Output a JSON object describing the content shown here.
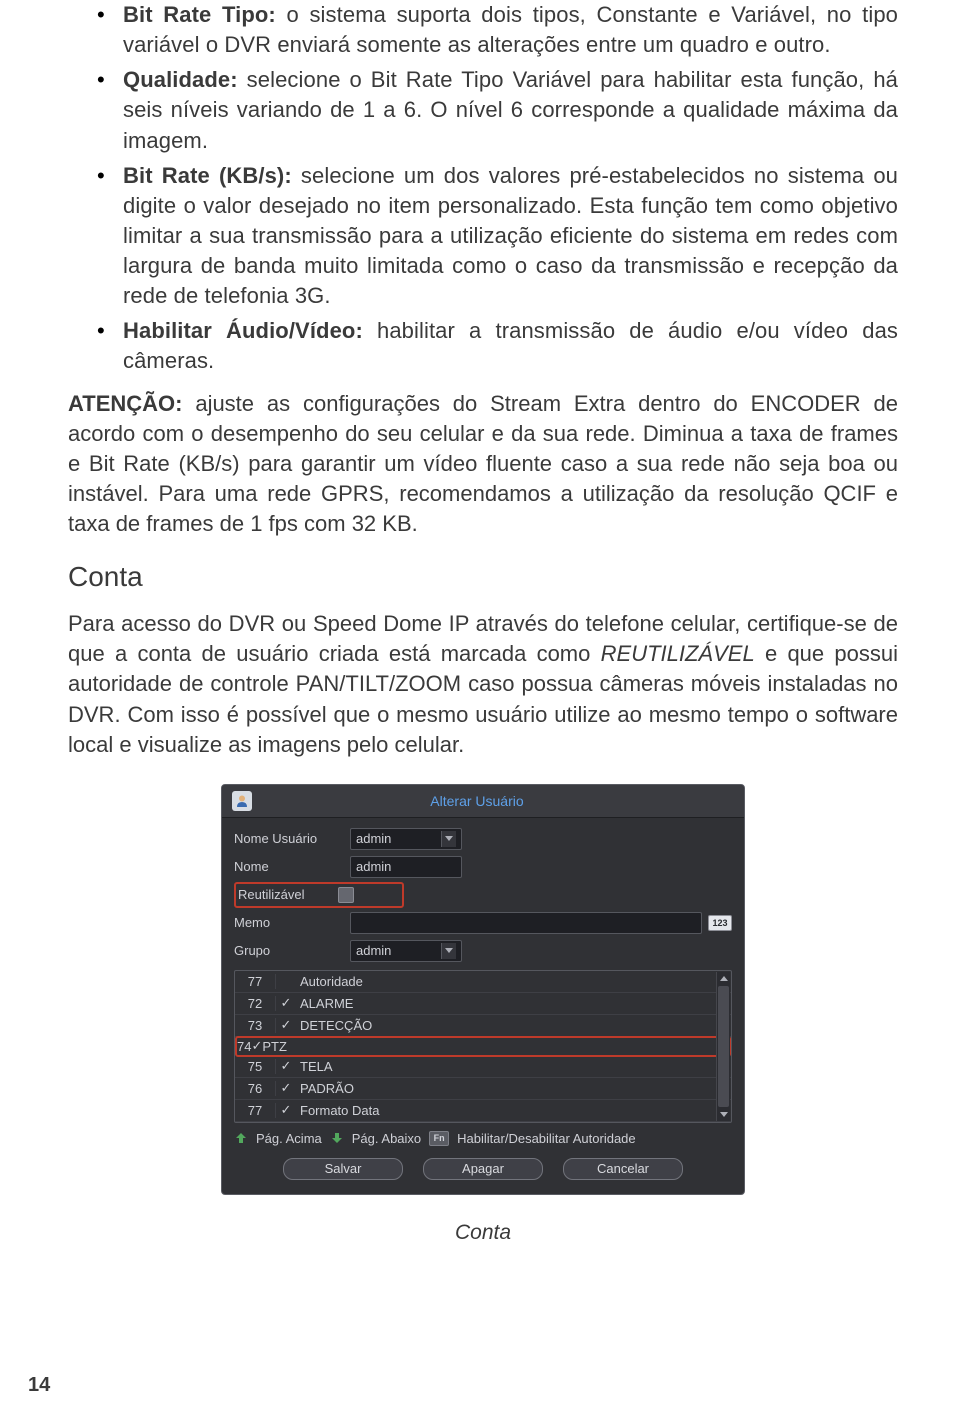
{
  "bullets": [
    {
      "label": "Bit Rate Tipo:",
      "text": "o sistema suporta dois tipos, Constante e Variável, no tipo variável o DVR enviará somente as alterações entre um quadro e outro."
    },
    {
      "label": "Qualidade:",
      "text": "selecione o Bit Rate Tipo Variável para habilitar esta função, há seis níveis variando de 1 a 6. O nível 6 corresponde a qualidade máxima da imagem."
    },
    {
      "label": "Bit Rate (KB/s):",
      "text": "selecione um dos valores pré-estabelecidos no sistema ou digite o valor desejado no item personalizado. Esta função tem como objetivo limitar a sua transmissão para a utilização eficiente do sistema em redes com largura de banda muito limitada como o caso da transmissão e recepção da rede de telefonia 3G."
    },
    {
      "label": "Habilitar Áudio/Vídeo:",
      "text": "habilitar a transmissão de áudio e/ou vídeo das câmeras."
    }
  ],
  "attention": {
    "label": "ATENÇÃO:",
    "text": "ajuste as configurações do Stream Extra dentro do ENCODER de acordo com o desempenho do seu celular e da sua rede. Diminua a taxa de frames e Bit Rate (KB/s) para garantir um vídeo fluente caso a sua rede não seja boa ou instável. Para uma rede GPRS, recomendamos a utilização da resolução QCIF e taxa de frames de 1 fps com 32 KB."
  },
  "section_title": "Conta",
  "account_paragraph_pre": "Para acesso do DVR ou Speed Dome IP através do telefone celular, certifique-se  de que a conta de usuário criada está marcada como ",
  "account_paragraph_em": "REUTILIZÁVEL",
  "account_paragraph_post": " e que possui autoridade de controle PAN/TILT/ZOOM caso possua câmeras móveis instaladas no DVR. Com isso é possível que o mesmo usuário utilize ao mesmo tempo o software local e visualize as imagens pelo celular.",
  "dialog": {
    "title": "Alterar Usuário",
    "labels": {
      "username": "Nome Usuário",
      "name": "Nome",
      "reusable": "Reutilizável",
      "memo": "Memo",
      "group": "Grupo"
    },
    "values": {
      "username": "admin",
      "name": "admin",
      "memo": "",
      "group": "admin",
      "ime": "123"
    },
    "perm_header": "Autoridade",
    "permissions": [
      {
        "idx": "77",
        "checked": false,
        "name": "Autoridade",
        "header": true
      },
      {
        "idx": "72",
        "checked": true,
        "name": "ALARME"
      },
      {
        "idx": "73",
        "checked": true,
        "name": "DETECÇÃO"
      },
      {
        "idx": "74",
        "checked": true,
        "name": "PTZ",
        "highlight": true
      },
      {
        "idx": "75",
        "checked": true,
        "name": "TELA"
      },
      {
        "idx": "76",
        "checked": true,
        "name": "PADRÃO"
      },
      {
        "idx": "77",
        "checked": true,
        "name": "Formato Data"
      }
    ],
    "pager": {
      "up": "Pág. Acima",
      "down": "Pág. Abaixo",
      "fn": "Fn",
      "toggle": "Habilitar/Desabilitar Autoridade"
    },
    "buttons": {
      "save": "Salvar",
      "delete": "Apagar",
      "cancel": "Cancelar"
    }
  },
  "caption": "Conta",
  "page_number": "14"
}
